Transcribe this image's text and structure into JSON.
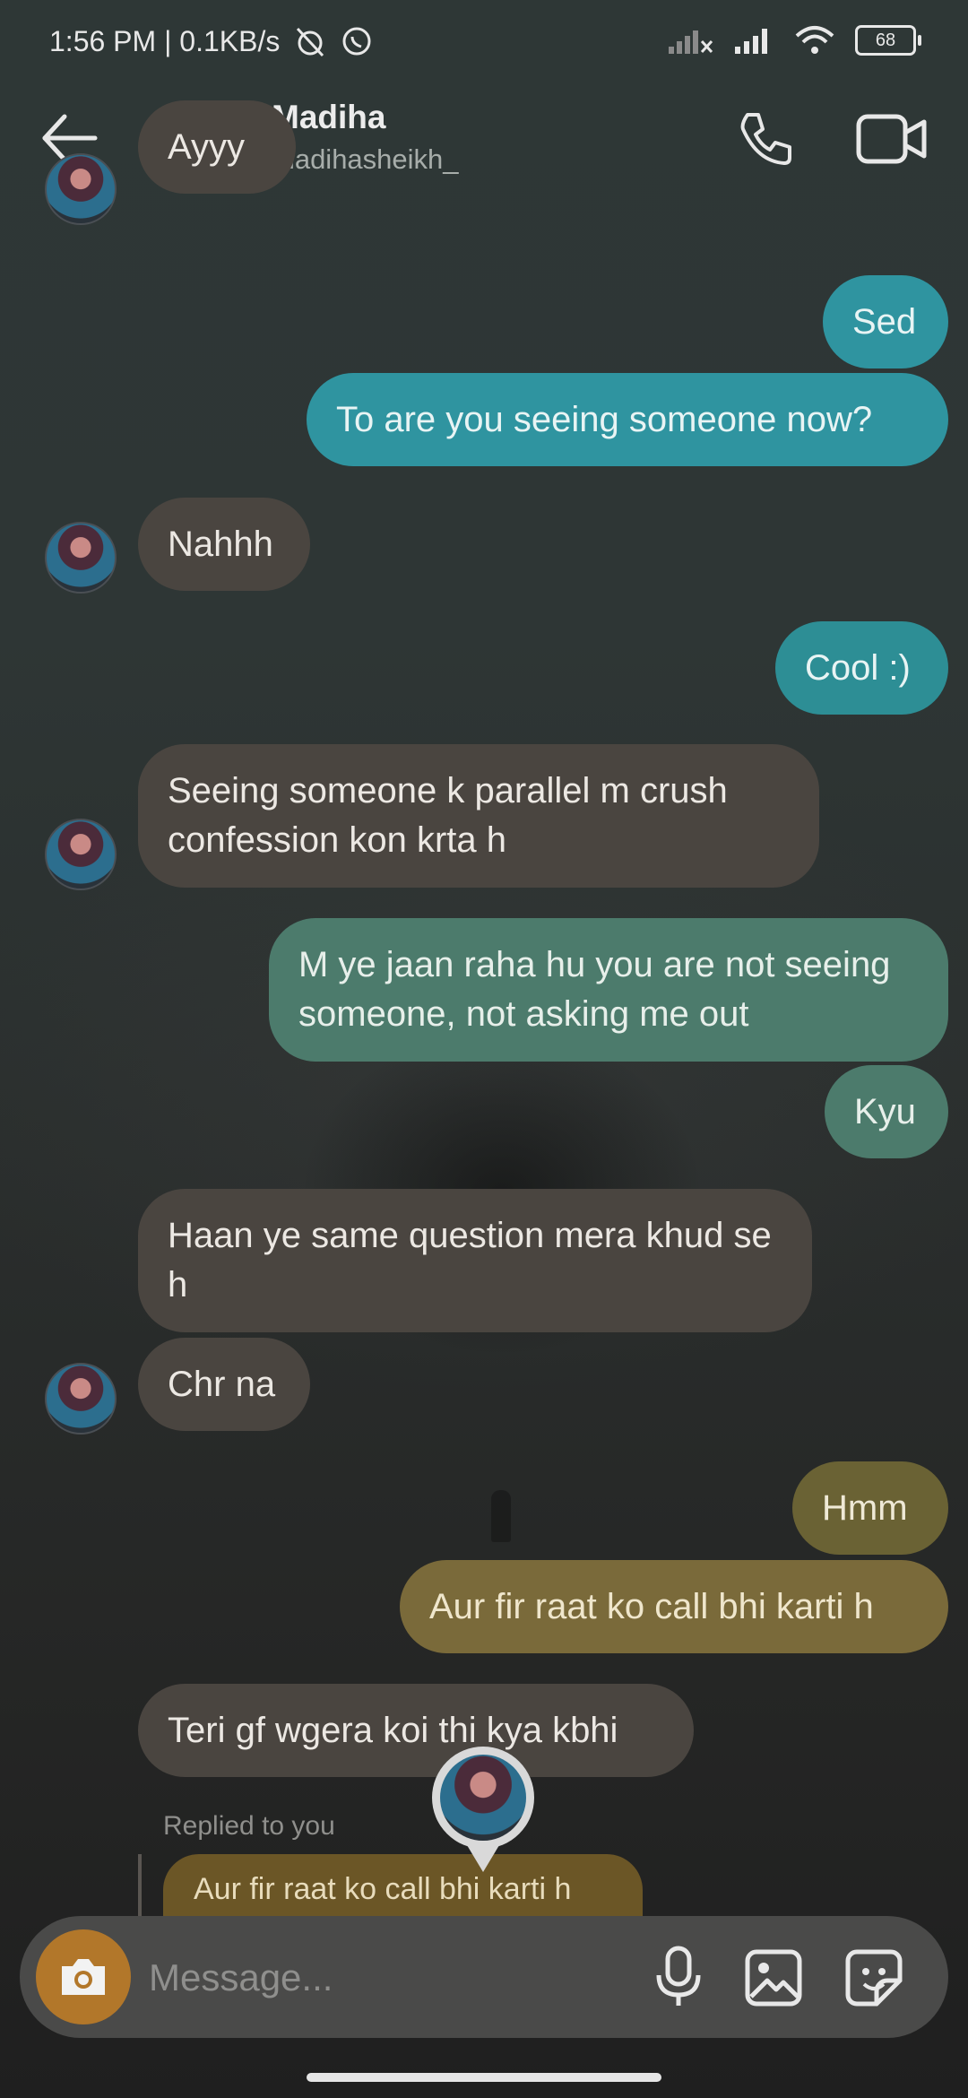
{
  "status_bar": {
    "time_speed": "1:56 PM | 0.1KB/s",
    "battery": "68"
  },
  "header": {
    "name": "Madiha",
    "username": "madihasheikh_"
  },
  "messages": [
    {
      "dir": "in",
      "text": "Ayyy"
    },
    {
      "dir": "out",
      "text": "Sed"
    },
    {
      "dir": "out",
      "text": "To are you seeing someone now?"
    },
    {
      "dir": "in",
      "text": "Nahhh"
    },
    {
      "dir": "out",
      "text": "Cool :)"
    },
    {
      "dir": "in",
      "text": "Seeing someone k parallel m crush confession kon krta h"
    },
    {
      "dir": "out",
      "text": "M ye jaan raha hu you are not seeing someone, not asking me out"
    },
    {
      "dir": "out",
      "text": "Kyu"
    },
    {
      "dir": "in",
      "text": "Haan ye same question mera khud se h"
    },
    {
      "dir": "in",
      "text": "Chr na"
    },
    {
      "dir": "out",
      "text": "Hmm"
    },
    {
      "dir": "out",
      "text": "Aur fir raat ko call bhi karti h"
    },
    {
      "dir": "in",
      "text": "Teri gf wgera koi thi kya kbhi"
    }
  ],
  "reply": {
    "label": "Replied to you",
    "quoted": "Aur fir raat ko call bhi karti h"
  },
  "composer": {
    "placeholder": "Message..."
  },
  "colors": {
    "incoming": "#4a4540",
    "outgoing_teal": "#2f94a0",
    "outgoing_green": "#4c7b6c",
    "outgoing_gold": "#6f6536",
    "camera_button": "#b2772a"
  }
}
